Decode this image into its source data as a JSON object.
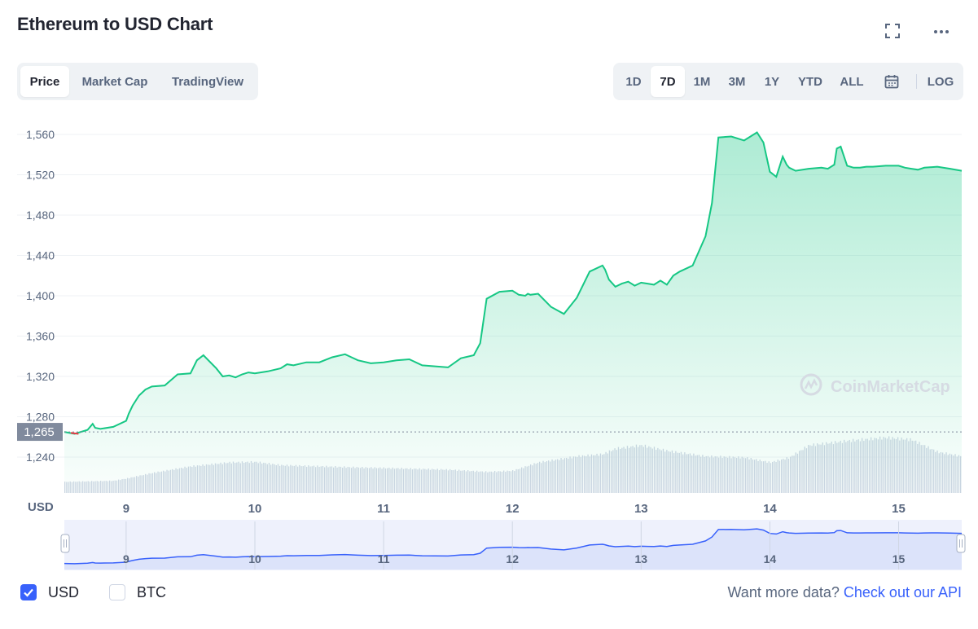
{
  "header": {
    "title": "Ethereum to USD Chart"
  },
  "tabs": [
    {
      "label": "Price",
      "active": true
    },
    {
      "label": "Market Cap",
      "active": false
    },
    {
      "label": "TradingView",
      "active": false
    }
  ],
  "ranges": [
    {
      "label": "1D",
      "active": false
    },
    {
      "label": "7D",
      "active": true
    },
    {
      "label": "1M",
      "active": false
    },
    {
      "label": "3M",
      "active": false
    },
    {
      "label": "1Y",
      "active": false
    },
    {
      "label": "YTD",
      "active": false
    },
    {
      "label": "ALL",
      "active": false
    }
  ],
  "log_label": "LOG",
  "icons": {
    "fullscreen": "fullscreen-icon",
    "more": "more-icon",
    "calendar": "calendar-icon"
  },
  "colors": {
    "line": "#16c784",
    "area_top": "#16c784",
    "volume": "#cfd6e4",
    "navigator_line": "#3861fb",
    "navigator_fill": "#e3e8fc",
    "price_tag_bg": "#808a9d",
    "accent": "#3861fb"
  },
  "chart_data": {
    "type": "area",
    "currency_label": "USD",
    "y_ticks": [
      1240,
      1280,
      1320,
      1360,
      1400,
      1440,
      1480,
      1520,
      1560
    ],
    "ylim": [
      1212,
      1575
    ],
    "x_ticks": [
      "9",
      "10",
      "11",
      "12",
      "13",
      "14",
      "15"
    ],
    "x_tick_days": [
      9,
      10,
      11,
      12,
      13,
      14,
      15
    ],
    "xlim": [
      8.52,
      15.49
    ],
    "reference_price": 1265,
    "reference_price_label": "1,265",
    "watermark": "CoinMarketCap",
    "series": [
      {
        "x": [
          8.52,
          8.6,
          8.7,
          8.74,
          8.76,
          8.8,
          8.9,
          9.0,
          9.02,
          9.05,
          9.1,
          9.15,
          9.2,
          9.3,
          9.4,
          9.5,
          9.55,
          9.6,
          9.7,
          9.75,
          9.8,
          9.85,
          9.9,
          9.95,
          10.0,
          10.1,
          10.2,
          10.25,
          10.3,
          10.4,
          10.5,
          10.6,
          10.7,
          10.75,
          10.8,
          10.9,
          11.0,
          11.1,
          11.2,
          11.3,
          11.4,
          11.5,
          11.6,
          11.7,
          11.75,
          11.8,
          11.9,
          12.0,
          12.05,
          12.1,
          12.12,
          12.14,
          12.2,
          12.3,
          12.4,
          12.5,
          12.6,
          12.7,
          12.72,
          12.75,
          12.8,
          12.85,
          12.9,
          12.95,
          13.0,
          13.05,
          13.1,
          13.15,
          13.2,
          13.25,
          13.3,
          13.4,
          13.5,
          13.55,
          13.6,
          13.7,
          13.8,
          13.9,
          13.95,
          14.0,
          14.05,
          14.1,
          14.13,
          14.15,
          14.2,
          14.3,
          14.4,
          14.45,
          14.5,
          14.52,
          14.55,
          14.6,
          14.65,
          14.7,
          14.75,
          14.8,
          14.9,
          15.0,
          15.05,
          15.1,
          15.15,
          15.2,
          15.3,
          15.4,
          15.49
        ],
        "y": [
          1265,
          1263,
          1267,
          1273,
          1269,
          1268,
          1270,
          1276,
          1283,
          1291,
          1301,
          1307,
          1310,
          1311,
          1322,
          1323,
          1336,
          1341,
          1328,
          1320,
          1321,
          1319,
          1322,
          1324,
          1323,
          1325,
          1328,
          1332,
          1331,
          1334,
          1334,
          1339,
          1342,
          1339,
          1336,
          1333,
          1334,
          1336,
          1337,
          1331,
          1330,
          1329,
          1338,
          1341,
          1353,
          1397,
          1404,
          1405,
          1401,
          1400,
          1402,
          1401,
          1402,
          1389,
          1382,
          1398,
          1424,
          1430,
          1426,
          1416,
          1409,
          1412,
          1414,
          1410,
          1413,
          1412,
          1411,
          1415,
          1411,
          1420,
          1424,
          1430,
          1459,
          1492,
          1557,
          1558,
          1554,
          1562,
          1552,
          1523,
          1518,
          1538,
          1530,
          1527,
          1524,
          1526,
          1527,
          1526,
          1530,
          1546,
          1548,
          1529,
          1527,
          1527,
          1528,
          1528,
          1529,
          1529,
          1527,
          1526,
          1525,
          1527,
          1528,
          1526,
          1524
        ],
        "name": ""
      }
    ],
    "volume_profile": [
      [
        8.52,
        0.2
      ],
      [
        8.9,
        0.22
      ],
      [
        9.0,
        0.26
      ],
      [
        9.2,
        0.36
      ],
      [
        9.5,
        0.48
      ],
      [
        9.8,
        0.55
      ],
      [
        10.0,
        0.56
      ],
      [
        10.2,
        0.5
      ],
      [
        10.5,
        0.48
      ],
      [
        10.8,
        0.46
      ],
      [
        11.0,
        0.45
      ],
      [
        11.5,
        0.42
      ],
      [
        11.8,
        0.38
      ],
      [
        12.0,
        0.4
      ],
      [
        12.2,
        0.55
      ],
      [
        12.5,
        0.66
      ],
      [
        12.7,
        0.7
      ],
      [
        12.8,
        0.8
      ],
      [
        13.0,
        0.86
      ],
      [
        13.2,
        0.76
      ],
      [
        13.5,
        0.66
      ],
      [
        13.8,
        0.64
      ],
      [
        14.0,
        0.55
      ],
      [
        14.15,
        0.64
      ],
      [
        14.3,
        0.86
      ],
      [
        14.6,
        0.94
      ],
      [
        14.9,
        1.0
      ],
      [
        15.1,
        0.96
      ],
      [
        15.3,
        0.74
      ],
      [
        15.49,
        0.66
      ]
    ]
  },
  "footer": {
    "usd_label": "USD",
    "usd_checked": true,
    "btc_label": "BTC",
    "btc_checked": false,
    "api_prefix": "Want more data?",
    "api_link": "Check out our API"
  }
}
